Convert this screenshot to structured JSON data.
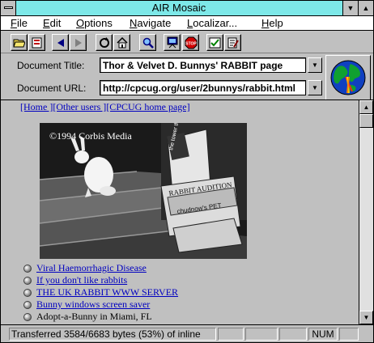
{
  "window": {
    "title": "AIR Mosaic"
  },
  "menu": [
    {
      "key": "F",
      "rest": "ile"
    },
    {
      "key": "E",
      "rest": "dit"
    },
    {
      "key": "O",
      "rest": "ptions"
    },
    {
      "key": "N",
      "rest": "avigate"
    },
    {
      "key": "L",
      "rest": "ocalizar..."
    },
    {
      "key": "H",
      "rest": "elp"
    }
  ],
  "toolbar": {
    "icons": [
      "open-folder-icon",
      "hotlist-icon",
      "back-icon",
      "forward-icon",
      "reload-icon",
      "home-icon",
      "find-icon",
      "kiosk-icon",
      "stop-icon",
      "checkmark-icon",
      "edit-icon"
    ]
  },
  "document": {
    "title_label": "Document Title:",
    "title_value": "Thor & Velvet D. Bunnys' RABBIT page",
    "url_label": "Document URL:",
    "url_value": "http://cpcug.org/user/2bunnys/rabbit.html"
  },
  "page": {
    "nav": [
      {
        "text": "[Home ]",
        "link": true
      },
      {
        "text": "[Other users ]",
        "link": true
      },
      {
        "text": "[CPCUG home page]",
        "link": true
      }
    ],
    "photo_caption": "©1994 Corbis Media",
    "photo_signs": [
      "the tower theatre",
      "RABBIT AUDITION",
      "chudnow's PET"
    ],
    "links": [
      {
        "text": "Viral Haemorrhagic Disease",
        "link": true
      },
      {
        "text": "If you don't like rabbits",
        "link": true
      },
      {
        "text": "THE UK RABBIT WWW SERVER",
        "link": true
      },
      {
        "text": "Bunny windows screen saver",
        "link": true
      },
      {
        "text": "Adopt-a-Bunny in Miami, FL",
        "link": false
      }
    ]
  },
  "status": {
    "message": "Transferred 3584/6683 bytes (53%) of inline",
    "num": "NUM"
  },
  "colors": {
    "titlebar": "#7de8e8",
    "link": "#0000c0",
    "chrome": "#c0c0c0"
  }
}
